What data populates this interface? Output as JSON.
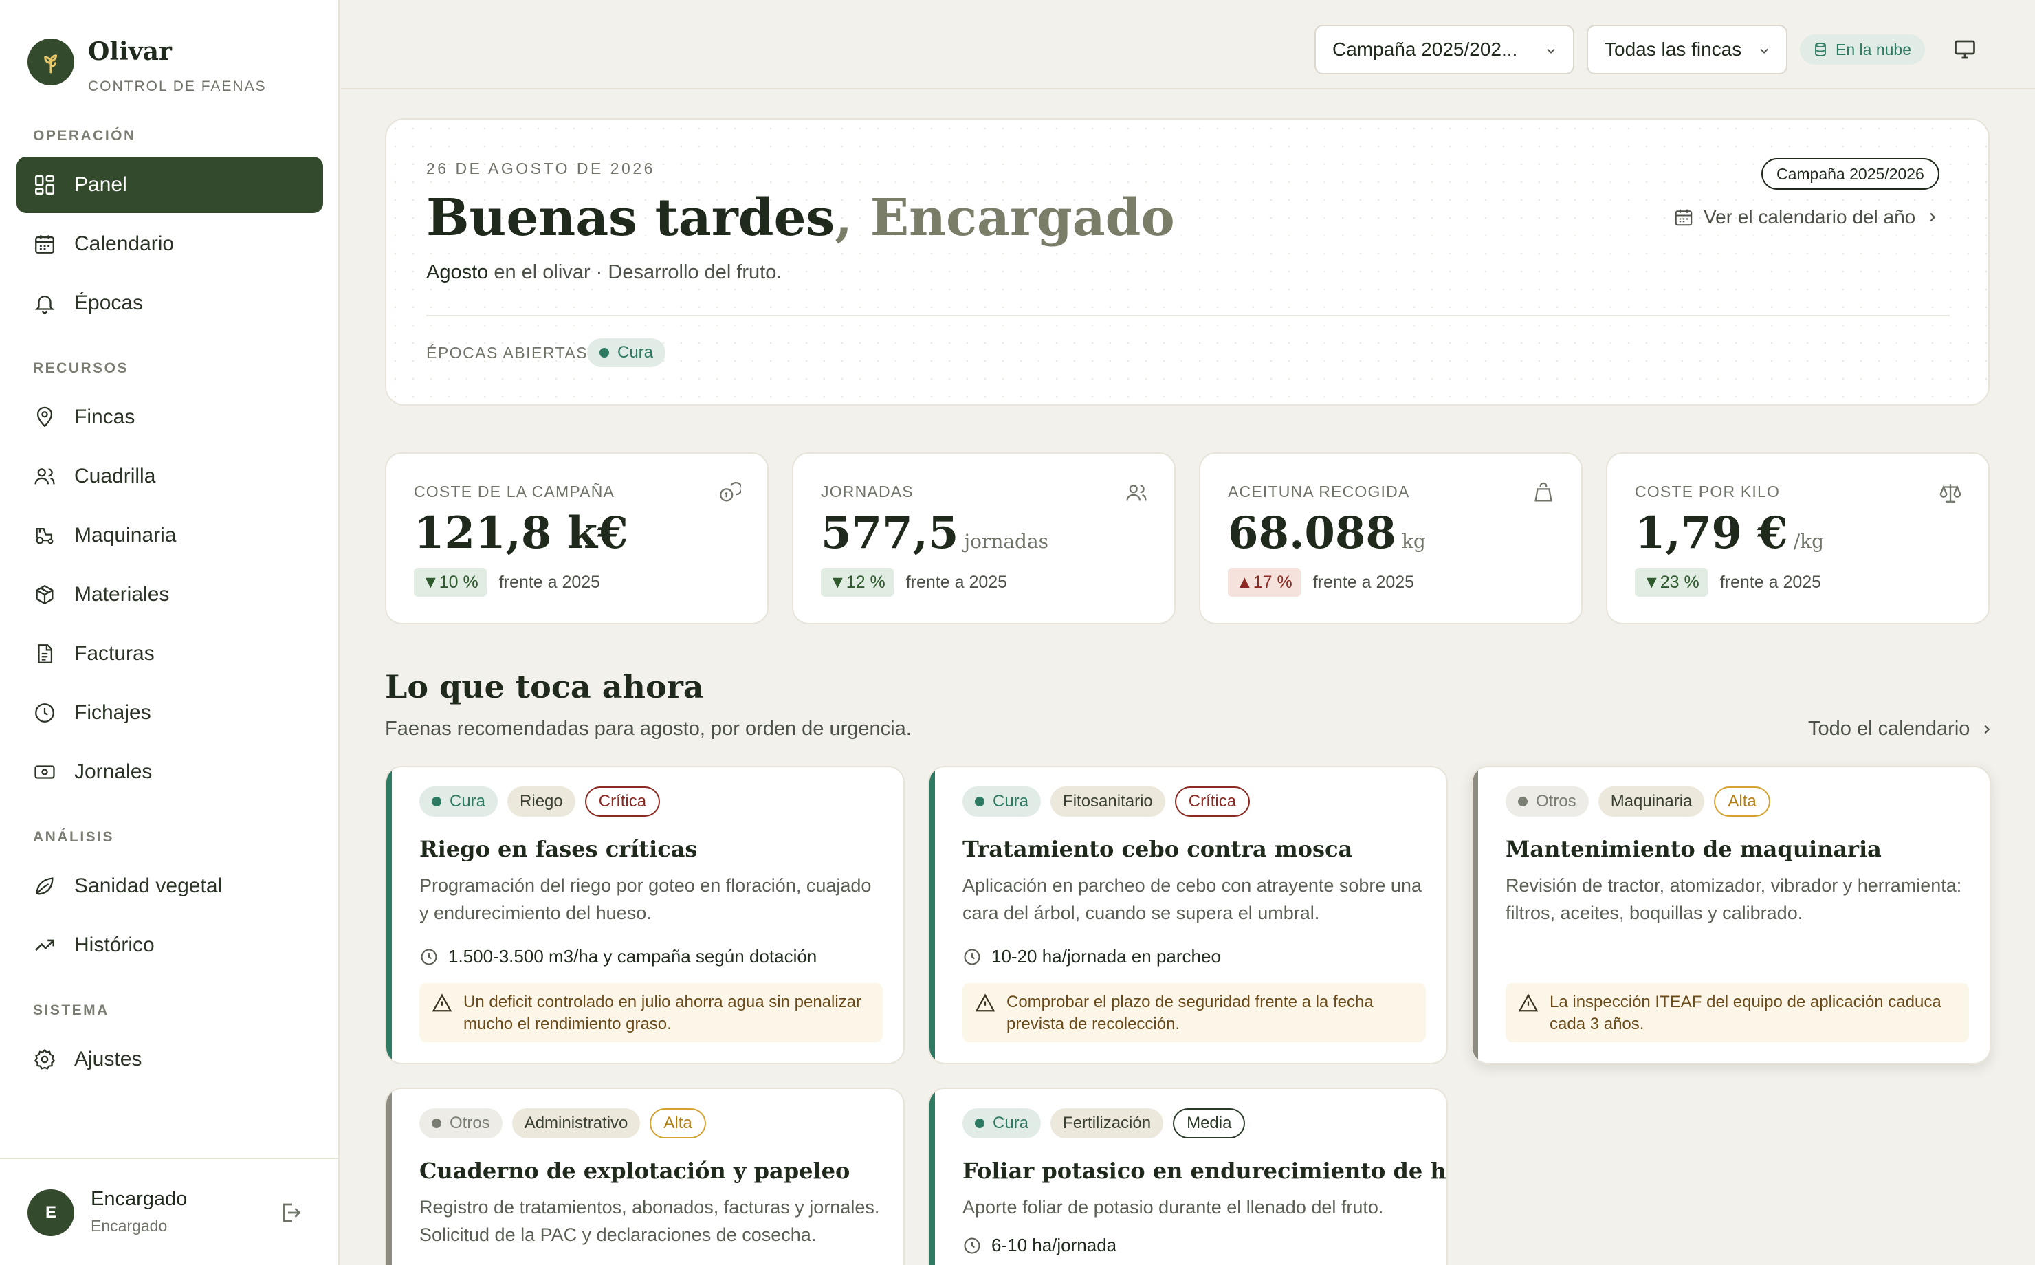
{
  "brand": {
    "name": "Olivar",
    "subtitle": "CONTROL DE FAENAS"
  },
  "nav": {
    "sections": [
      {
        "label": "OPERACIÓN"
      },
      {
        "label": "RECURSOS"
      },
      {
        "label": "ANÁLISIS"
      },
      {
        "label": "SISTEMA"
      }
    ],
    "items": [
      {
        "label": "Panel",
        "icon": "dashboard-icon"
      },
      {
        "label": "Calendario",
        "icon": "calendar-icon"
      },
      {
        "label": "Épocas",
        "icon": "bell-icon"
      },
      {
        "label": "Fincas",
        "icon": "map-pin-icon"
      },
      {
        "label": "Cuadrilla",
        "icon": "users-icon"
      },
      {
        "label": "Maquinaria",
        "icon": "tractor-icon"
      },
      {
        "label": "Materiales",
        "icon": "box-icon"
      },
      {
        "label": "Facturas",
        "icon": "file-icon"
      },
      {
        "label": "Fichajes",
        "icon": "clock-icon"
      },
      {
        "label": "Jornales",
        "icon": "banknote-icon"
      },
      {
        "label": "Sanidad vegetal",
        "icon": "leaf-icon"
      },
      {
        "label": "Histórico",
        "icon": "trend-icon"
      },
      {
        "label": "Ajustes",
        "icon": "gear-icon"
      }
    ]
  },
  "user": {
    "initial": "E",
    "name": "Encargado",
    "role": "Encargado"
  },
  "topbar": {
    "campaign_select": "Campaña 2025/202...",
    "farm_select": "Todas las fincas",
    "cloud_status": "En la nube"
  },
  "hero": {
    "date": "26 DE AGOSTO DE 2026",
    "greeting": "Buenas tardes",
    "comma": ",",
    "role": "Encargado",
    "month": "Agosto",
    "phase": "en el olivar · Desarrollo del fruto.",
    "campaign_badge": "Campaña 2025/2026",
    "calendar_link": "Ver el calendario del año",
    "open_epochs_label": "ÉPOCAS ABIERTAS",
    "open_epochs": [
      "Cura"
    ]
  },
  "kpis": [
    {
      "label": "COSTE DE LA CAMPAÑA",
      "value": "121,8 k€",
      "unit": "",
      "delta": "▼10 %",
      "compare": "frente a 2025",
      "icon": "coins-icon"
    },
    {
      "label": "JORNADAS",
      "value": "577,5",
      "unit": "jornadas",
      "delta": "▼12 %",
      "compare": "frente a 2025",
      "icon": "users-icon"
    },
    {
      "label": "ACEITUNA RECOGIDA",
      "value": "68.088",
      "unit": "kg",
      "delta": "▲17 %",
      "compare": "frente a 2025",
      "icon": "bag-icon"
    },
    {
      "label": "COSTE POR KILO",
      "value": "1,79 €",
      "unit": "/kg",
      "delta": "▼23 %",
      "compare": "frente a 2025",
      "icon": "scale-icon"
    }
  ],
  "section": {
    "title": "Lo que toca ahora",
    "subtitle": "Faenas recomendadas para agosto, por orden de urgencia.",
    "link": "Todo el calendario"
  },
  "tasks": [
    {
      "epoch": "Cura",
      "category": "Riego",
      "priority": "Crítica",
      "title": "Riego en fases críticas",
      "description": "Programación del riego por goteo en floración, cuajado y endurecimiento del hueso.",
      "meta": "1.500-3.500 m3/ha y campaña según dotación",
      "warning": "Un deficit controlado en julio ahorra agua sin penalizar mucho el rendimiento graso."
    },
    {
      "epoch": "Cura",
      "category": "Fitosanitario",
      "priority": "Crítica",
      "title": "Tratamiento cebo contra mosca",
      "description": "Aplicación en parcheo de cebo con atrayente sobre una cara del árbol, cuando se supera el umbral.",
      "meta": "10-20 ha/jornada en parcheo",
      "warning": "Comprobar el plazo de seguridad frente a la fecha prevista de recolección."
    },
    {
      "epoch": "Otros",
      "category": "Maquinaria",
      "priority": "Alta",
      "title": "Mantenimiento de maquinaria",
      "description": "Revisión de tractor, atomizador, vibrador y herramienta: filtros, aceites, boquillas y calibrado.",
      "meta": "",
      "warning": "La inspección ITEAF del equipo de aplicación caduca cada 3 años."
    },
    {
      "epoch": "Otros",
      "category": "Administrativo",
      "priority": "Alta",
      "title": "Cuaderno de explotación y papeleo",
      "description": "Registro de tratamientos, abonados, facturas y jornales. Solicitud de la PAC y declaraciones de cosecha.",
      "meta": "",
      "warning": ""
    },
    {
      "epoch": "Cura",
      "category": "Fertilización",
      "priority": "Media",
      "title": "Foliar potasico en endurecimiento de hueso",
      "description": "Aporte foliar de potasio durante el llenado del fruto.",
      "meta": "6-10 ha/jornada",
      "warning": ""
    }
  ]
}
